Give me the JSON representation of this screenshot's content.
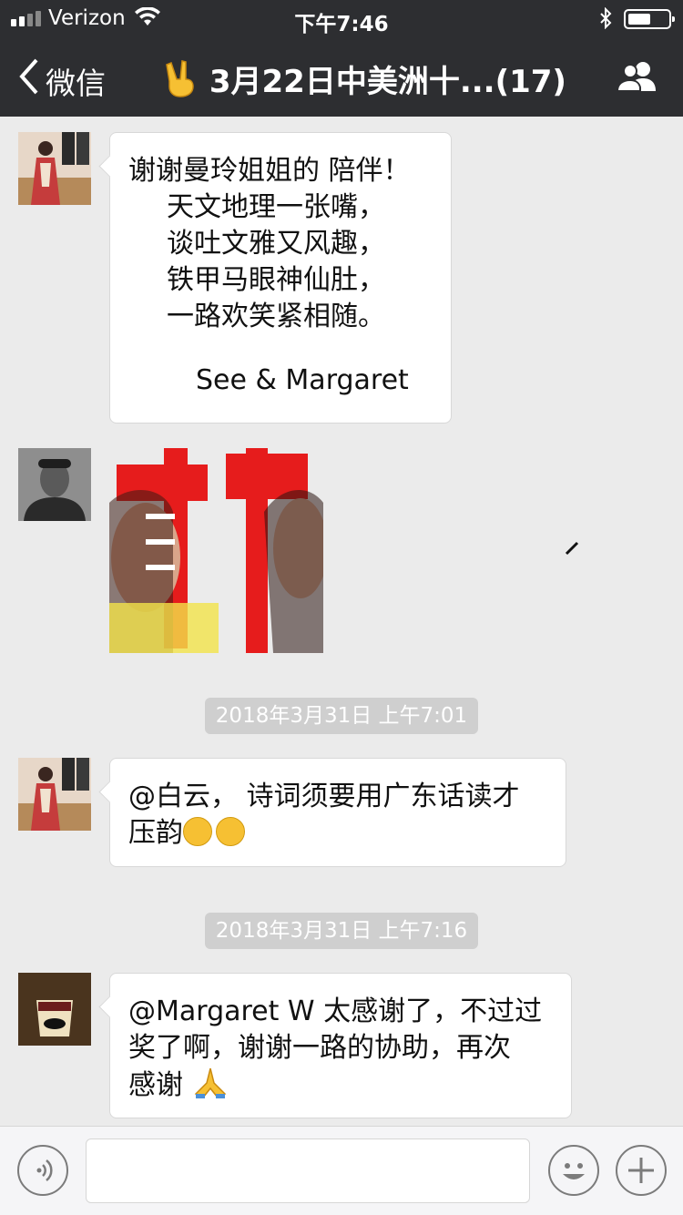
{
  "status_bar": {
    "carrier": "Verizon",
    "time": "下午7:46"
  },
  "nav": {
    "back_label": "微信",
    "title_emoji": "peace-hand-icon",
    "title": "3月22日中美洲十...(17)"
  },
  "messages": [
    {
      "type": "text",
      "lines": [
        "谢谢曼玲姐姐的 陪伴！",
        "天文地理一张嘴，",
        "谈吐文雅又风趣，",
        "铁甲马眼神仙肚，",
        "一路欢笑紧相随。"
      ],
      "signature": "See & Margaret"
    },
    {
      "type": "image",
      "sticker_text": "真棒"
    },
    {
      "type": "timestamp",
      "text": "2018年3月31日 上午7:01"
    },
    {
      "type": "text",
      "line1": "@白云， 诗词须要用广东话读才",
      "line2": "压韵",
      "emojis": [
        "thinking-face-icon",
        "thinking-face-icon"
      ]
    },
    {
      "type": "timestamp",
      "text": "2018年3月31日 上午7:16"
    },
    {
      "type": "text",
      "line1": "@Margaret W 太感谢了，不过过",
      "line2": "奖了啊，谢谢一路的协助，再次",
      "line3": "感谢",
      "emoji": "folded-hands-icon"
    }
  ],
  "colors": {
    "nav_bg": "#2d2e31",
    "chat_bg": "#ebebeb",
    "bubble": "#ffffff",
    "timestamp_bg": "#cfcfcf"
  }
}
